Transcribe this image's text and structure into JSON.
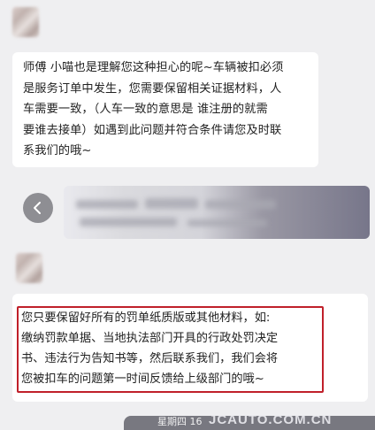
{
  "messages": [
    {
      "sender": "other",
      "text": "师傅 小喵也是理解您这种担心的呢~车辆被扣必须\n是服务订单中发生，您需要保留相关证据材料，人\n车需要一致，（人车一致的意思是 谁注册的就需\n要谁去接单）如遇到此问题并符合条件请您及时联\n系我们的哦~"
    },
    {
      "sender": "self",
      "text": ""
    },
    {
      "sender": "other",
      "text": "您只要保留好所有的罚单纸质版或其他材料，如:\n缴纳罚款单据、当地执法部门开具的行政处罚决定\n书、违法行为告知书等，然后联系我们，我们会将\n您被扣车的问题第一时间反馈给上级部门的哦~"
    }
  ],
  "footer": {
    "time": "星期四 16"
  },
  "watermark": "JCAUTO.COM.CN",
  "colors": {
    "background": "#efeff1",
    "bubble": "#ffffff",
    "highlight": "#c0202a"
  },
  "icons": {
    "back": "chevron-left-icon"
  }
}
